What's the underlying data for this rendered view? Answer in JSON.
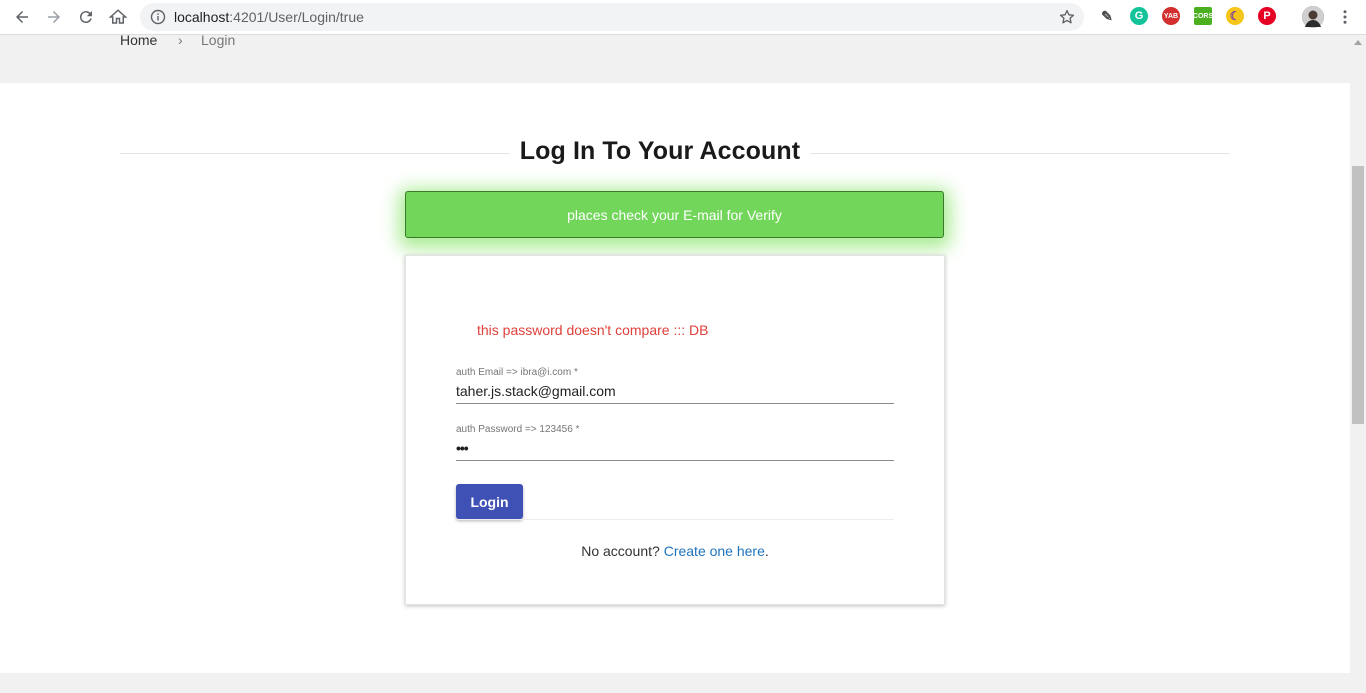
{
  "browser": {
    "url_host": "localhost",
    "url_path": ":4201/User/Login/true",
    "extensions": [
      {
        "name": "eyedropper-icon",
        "color": "#4a4a4a",
        "label": ""
      },
      {
        "name": "grammarly-icon",
        "color": "#15c39a",
        "label": ""
      },
      {
        "name": "yab-icon",
        "color": "#d32f2f",
        "label": "YAB"
      },
      {
        "name": "cors-icon",
        "color": "#4caf20",
        "label": "CORS"
      },
      {
        "name": "moon-icon",
        "color": "#f5c518",
        "label": ""
      },
      {
        "name": "pinterest-icon",
        "color": "#e60023",
        "label": ""
      }
    ]
  },
  "breadcrumb": {
    "home": "Home",
    "separator": "›",
    "current": "Login"
  },
  "page": {
    "title": "Log In To Your Account"
  },
  "toast": {
    "message": "places check your E-mail for Verify",
    "color": "#72d65a"
  },
  "login_form": {
    "error": "this password doesn't compare ::: DB",
    "email": {
      "label": "auth Email => ibra@i.com *",
      "value": "taher.js.stack@gmail.com"
    },
    "password": {
      "label": "auth Password => 123456 *",
      "value": "•••"
    },
    "submit_label": "Login",
    "no_account_text": "No account?",
    "create_link": "Create one here",
    "create_link_suffix": "."
  },
  "colors": {
    "primary_button": "#3f51b5",
    "error": "#e0403a",
    "link": "#1e73be"
  }
}
